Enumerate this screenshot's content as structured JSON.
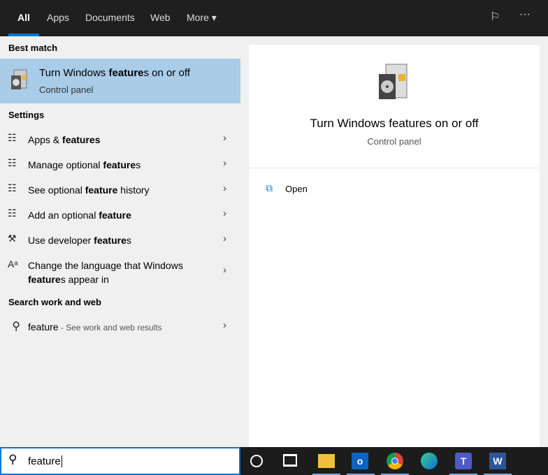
{
  "tabs": [
    {
      "label": "All"
    },
    {
      "label": "Apps"
    },
    {
      "label": "Documents"
    },
    {
      "label": "Web"
    },
    {
      "label": "More ▾"
    }
  ],
  "top_icons": {
    "feedback": "feedback-icon",
    "more": "···"
  },
  "best_match": {
    "header": "Best match",
    "pre": "Turn Windows ",
    "bold": "feature",
    "post": "s on or off",
    "sub": "Control panel"
  },
  "settings": {
    "header": "Settings",
    "items": [
      {
        "pre": "Apps & ",
        "bold": "features",
        "post": "",
        "icon": "☷"
      },
      {
        "pre": "Manage optional ",
        "bold": "feature",
        "post": "s",
        "icon": "☷"
      },
      {
        "pre": "See optional ",
        "bold": "feature",
        "post": " history",
        "icon": "☷"
      },
      {
        "pre": "Add an optional ",
        "bold": "feature",
        "post": "",
        "icon": "☷"
      },
      {
        "pre": "Use developer ",
        "bold": "feature",
        "post": "s",
        "icon": "⚒"
      },
      {
        "pre": "Change the language that Windows ",
        "bold": "feature",
        "post": "s appear in",
        "icon": "Aᵃ"
      }
    ]
  },
  "web": {
    "header": "Search work and web",
    "query": "feature",
    "hint": " - See work and web results"
  },
  "detail": {
    "title": "Turn Windows features on or off",
    "sub": "Control panel",
    "action": "Open"
  },
  "searchbox": {
    "value": "feature"
  },
  "chevron": "›"
}
